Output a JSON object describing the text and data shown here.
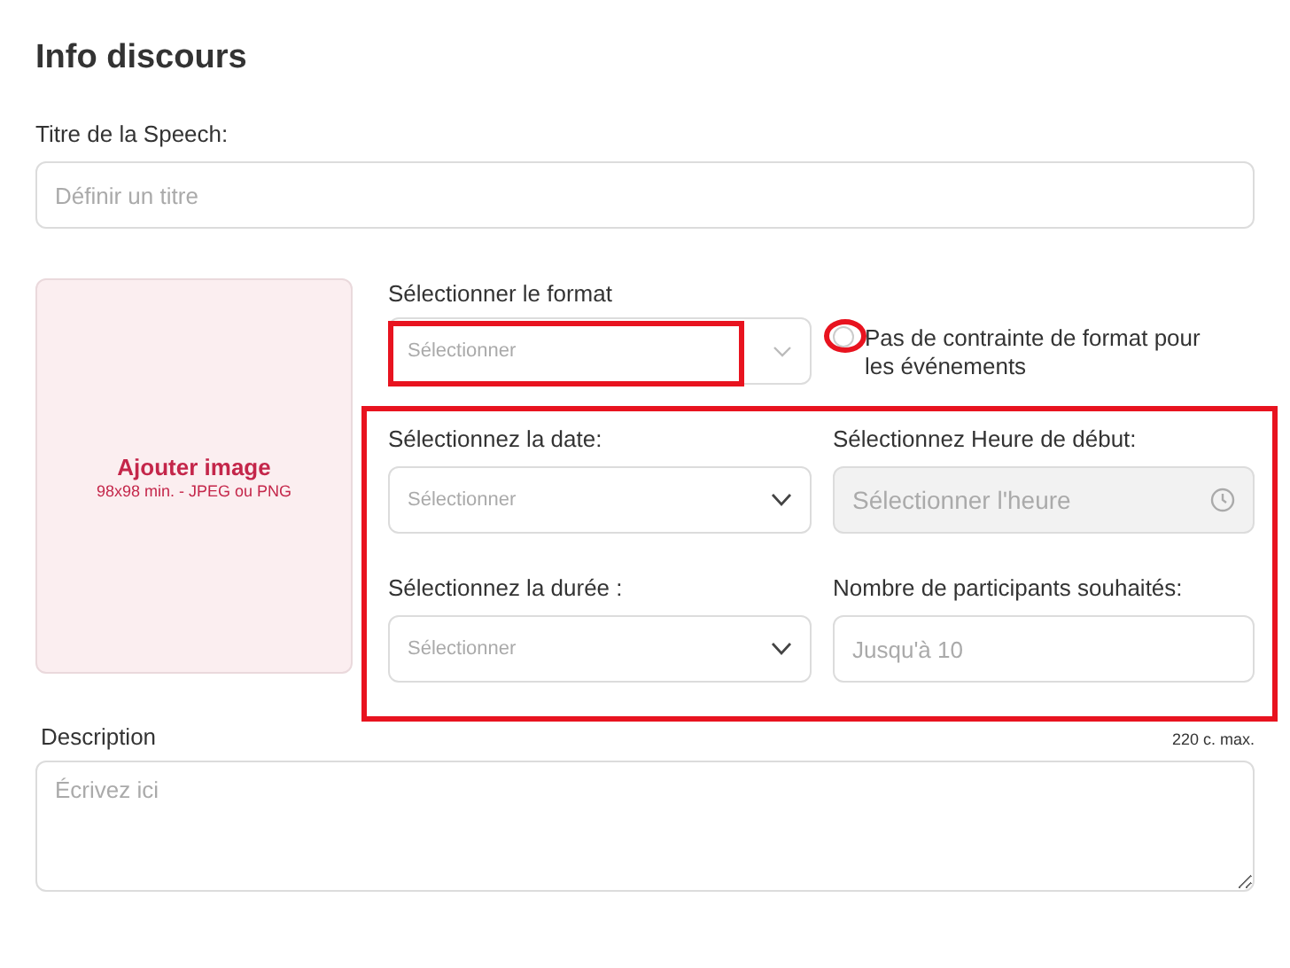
{
  "heading": "Info discours",
  "title_field": {
    "label": "Titre de la Speech:",
    "placeholder": "Définir un titre"
  },
  "image_upload": {
    "label": "Ajouter image",
    "hint": "98x98 min. - JPEG ou PNG"
  },
  "format": {
    "label": "Sélectionner le format",
    "placeholder": "Sélectionner"
  },
  "no_format_constraint": {
    "label": "Pas de contrainte de format pour les événements",
    "checked": false
  },
  "fields": [
    {
      "kind": "select",
      "label": "Sélectionnez la date:",
      "placeholder": "Sélectionner",
      "disabled": false
    },
    {
      "kind": "time",
      "label": "Sélectionnez Heure de début:",
      "placeholder": "Sélectionner l'heure",
      "disabled": true
    },
    {
      "kind": "select",
      "label": "Sélectionnez la durée :",
      "placeholder": "Sélectionner",
      "disabled": false
    },
    {
      "kind": "input",
      "label": "Nombre de participants souhaités:",
      "placeholder": "Jusqu'à 10",
      "disabled": false
    }
  ],
  "description": {
    "label": "Description",
    "limit": "220 c. max.",
    "placeholder": "Écrivez ici"
  }
}
